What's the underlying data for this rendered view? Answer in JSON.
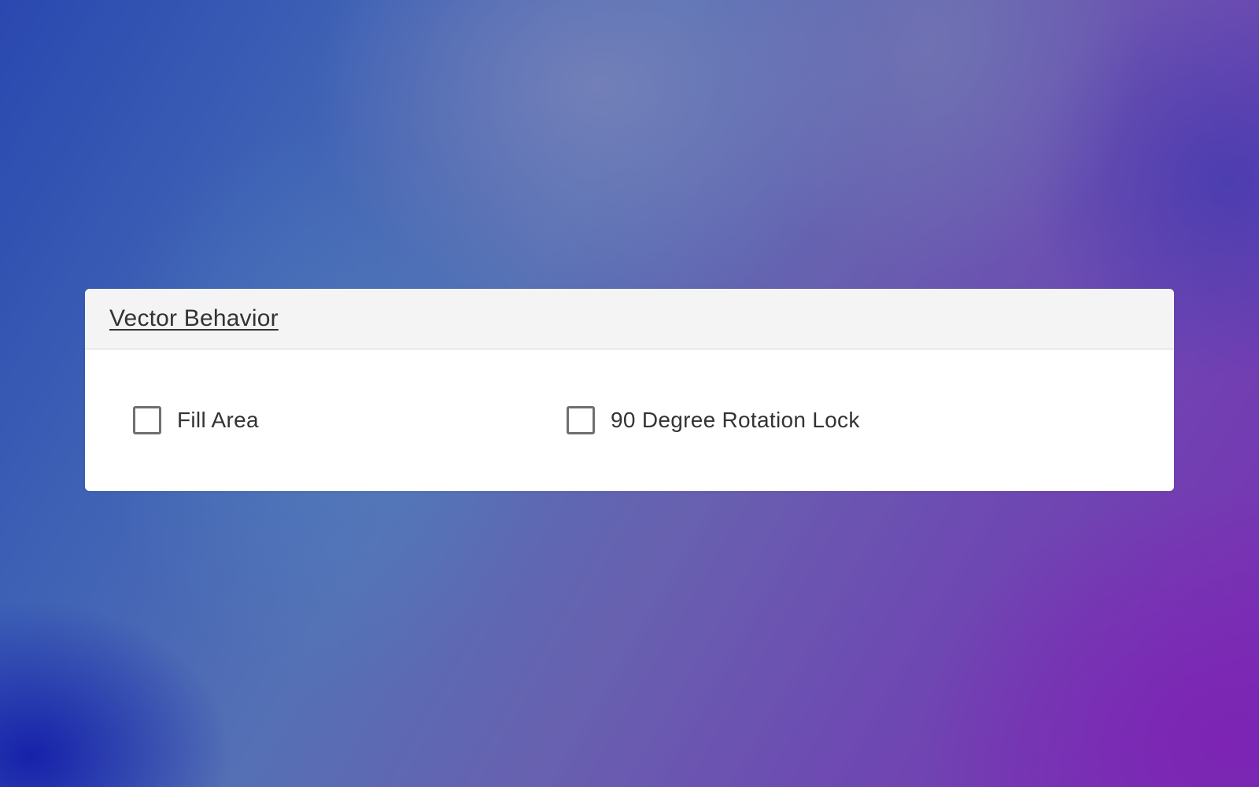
{
  "background": {
    "colors": [
      "#2a48b0",
      "#6860b0",
      "#7a2fb3",
      "#1a24b0"
    ]
  },
  "panel": {
    "title": "Vector Behavior",
    "options": [
      {
        "label": "Fill Area",
        "checked": false
      },
      {
        "label": "90 Degree Rotation Lock",
        "checked": false
      }
    ]
  }
}
